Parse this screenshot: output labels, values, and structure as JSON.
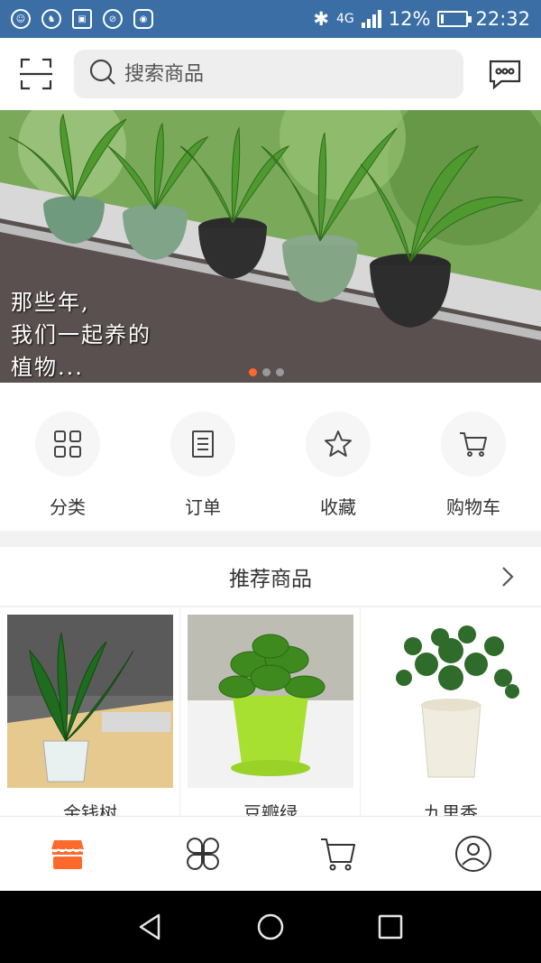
{
  "status_bar": {
    "network": "4G",
    "battery": "12%",
    "battery_level": 0.12,
    "time": "22:32"
  },
  "search": {
    "placeholder": "搜索商品"
  },
  "banner": {
    "caption_lines": [
      "那些年,",
      "我们一起养的",
      "植物..."
    ],
    "slide_count": 3,
    "active_slide": 0
  },
  "quick_menu": [
    {
      "label": "分类",
      "icon": "grid-icon"
    },
    {
      "label": "订单",
      "icon": "order-icon"
    },
    {
      "label": "收藏",
      "icon": "star-icon"
    },
    {
      "label": "购物车",
      "icon": "cart-icon"
    }
  ],
  "recommended": {
    "title": "推荐商品",
    "products": [
      {
        "name": "金钱树"
      },
      {
        "name": "豆瓣绿"
      },
      {
        "name": "九里香"
      }
    ]
  },
  "tabbar": [
    {
      "name": "home",
      "icon": "shop-icon",
      "active": true
    },
    {
      "name": "category",
      "icon": "category-icon",
      "active": false
    },
    {
      "name": "cart",
      "icon": "cart-icon",
      "active": false
    },
    {
      "name": "profile",
      "icon": "user-icon",
      "active": false
    }
  ],
  "colors": {
    "accent": "#ff6a2c",
    "status_bar": "#3a6ea5"
  }
}
